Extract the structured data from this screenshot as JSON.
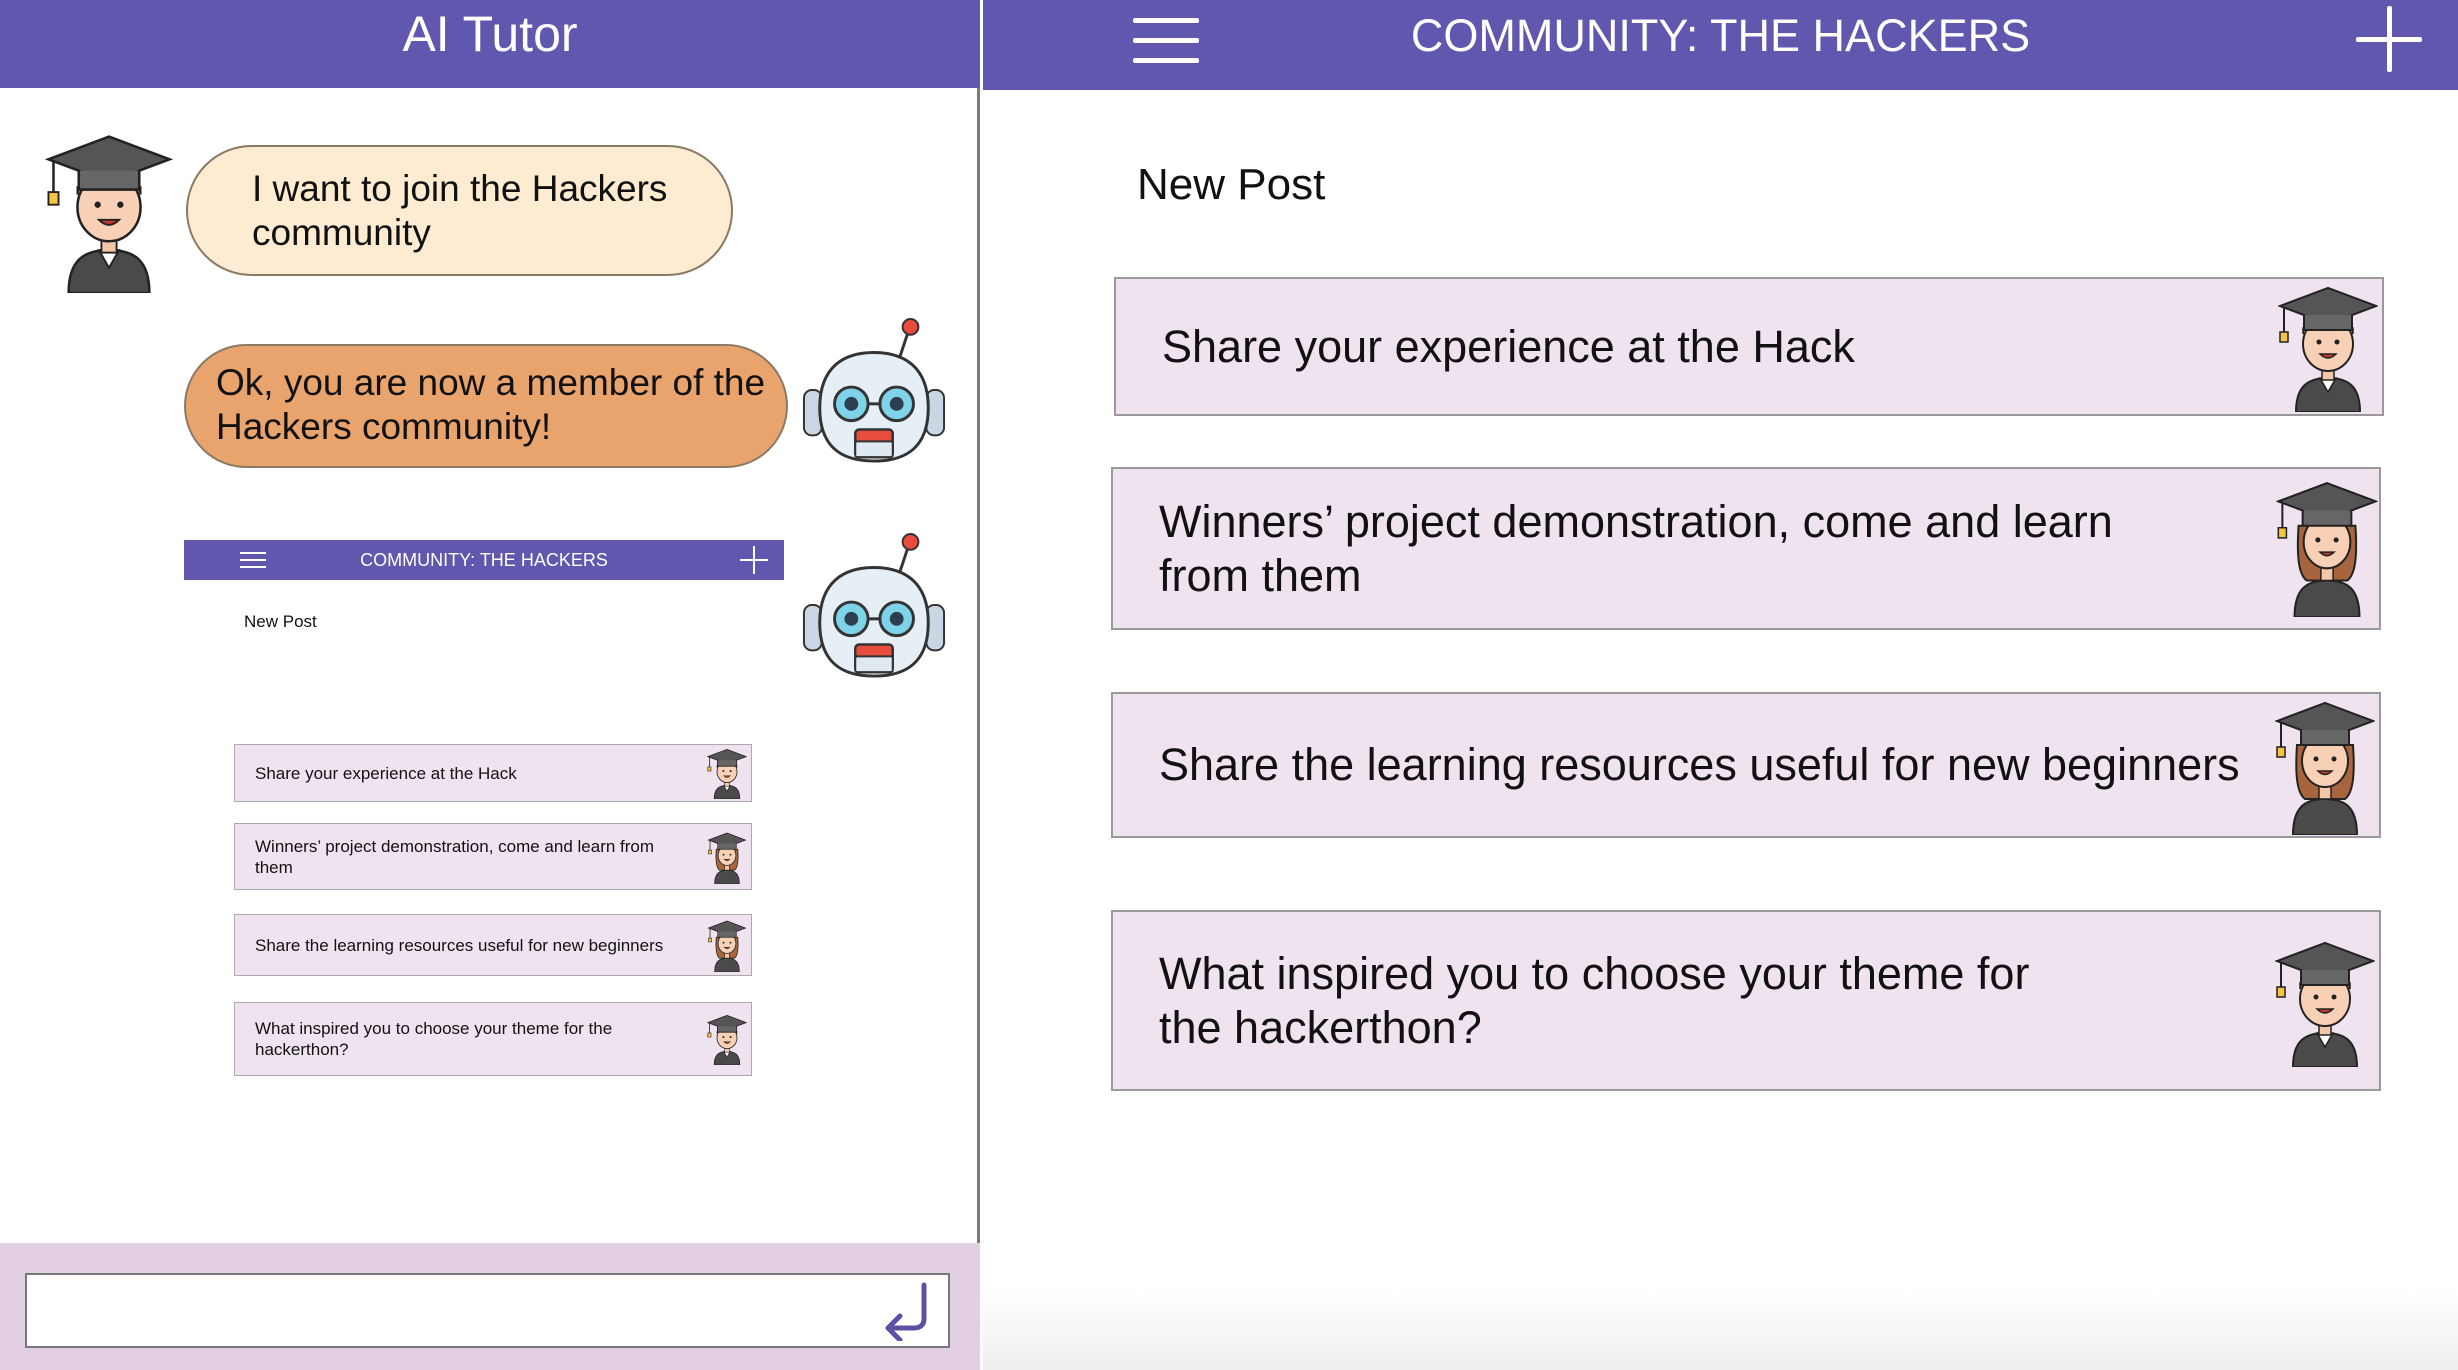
{
  "colors": {
    "header": "#6157ae",
    "card_bg": "#efe3ef",
    "user_bubble": "#fdebd2",
    "bot_bubble": "#e9a46e",
    "input_bar": "#e3cfe3"
  },
  "tutor": {
    "title": "AI Tutor",
    "messages": [
      {
        "sender": "user",
        "text": "I want to join the Hackers community",
        "avatar_icon": "male-graduate-icon"
      },
      {
        "sender": "bot",
        "text": "Ok, you are now a member of the Hackers community!",
        "avatar_icon": "robot-icon"
      }
    ],
    "preview": {
      "title": "COMMUNITY: THE HACKERS",
      "new_post": "New Post",
      "posts": [
        {
          "text": "Share your experience at the Hack",
          "avatar_icon": "male-graduate-icon"
        },
        {
          "text": "Winners’ project demonstration, come and learn from them",
          "avatar_icon": "female-graduate-icon"
        },
        {
          "text": "Share the learning resources useful for new beginners",
          "avatar_icon": "female-graduate-icon"
        },
        {
          "text": "What inspired you to  choose your theme for the hackerthon?",
          "avatar_icon": "male-graduate-icon"
        }
      ]
    },
    "input": {
      "value": "",
      "placeholder": "",
      "send_icon": "enter-arrow-icon"
    }
  },
  "community": {
    "title": "COMMUNITY: THE HACKERS",
    "menu_icon": "hamburger-menu-icon",
    "add_icon": "plus-icon",
    "new_post": "New Post",
    "posts": [
      {
        "text": "Share your experience at the Hack",
        "avatar_icon": "male-graduate-icon"
      },
      {
        "text": "Winners’ project demonstration, come and learn from them",
        "avatar_icon": "female-graduate-icon"
      },
      {
        "text": "Share the learning resources useful for new beginners",
        "avatar_icon": "female-graduate-icon"
      },
      {
        "text": "What inspired you to  choose your theme for the hackerthon?",
        "avatar_icon": "male-graduate-icon"
      }
    ]
  }
}
